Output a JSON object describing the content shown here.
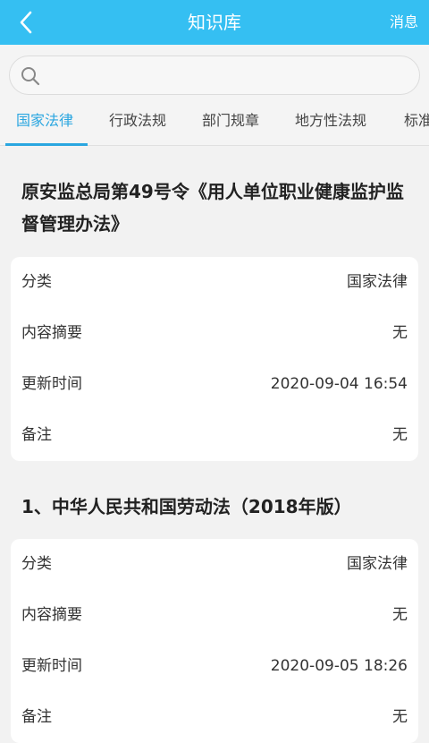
{
  "header": {
    "title": "知识库",
    "message_label": "消息",
    "back_icon": "back-arrow-icon"
  },
  "search": {
    "icon": "search-icon",
    "placeholder": ""
  },
  "tabs": [
    {
      "label": "国家法律",
      "active": true
    },
    {
      "label": "行政法规",
      "active": false
    },
    {
      "label": "部门规章",
      "active": false
    },
    {
      "label": "地方性法规",
      "active": false
    },
    {
      "label": "标准",
      "active": false
    }
  ],
  "entries": [
    {
      "title": "原安监总局第49号令《用人单位职业健康监护监督管理办法》",
      "fields": [
        {
          "label": "分类",
          "value": "国家法律"
        },
        {
          "label": "内容摘要",
          "value": "无"
        },
        {
          "label": "更新时间",
          "value": "2020-09-04 16:54"
        },
        {
          "label": "备注",
          "value": "无"
        }
      ]
    },
    {
      "title": "1、中华人民共和国劳动法（2018年版）",
      "fields": [
        {
          "label": "分类",
          "value": "国家法律"
        },
        {
          "label": "内容摘要",
          "value": "无"
        },
        {
          "label": "更新时间",
          "value": "2020-09-05 18:26"
        },
        {
          "label": "备注",
          "value": "无"
        }
      ]
    }
  ],
  "colors": {
    "header_bg": "#35bff2",
    "tab_active": "#2aa6e0"
  }
}
